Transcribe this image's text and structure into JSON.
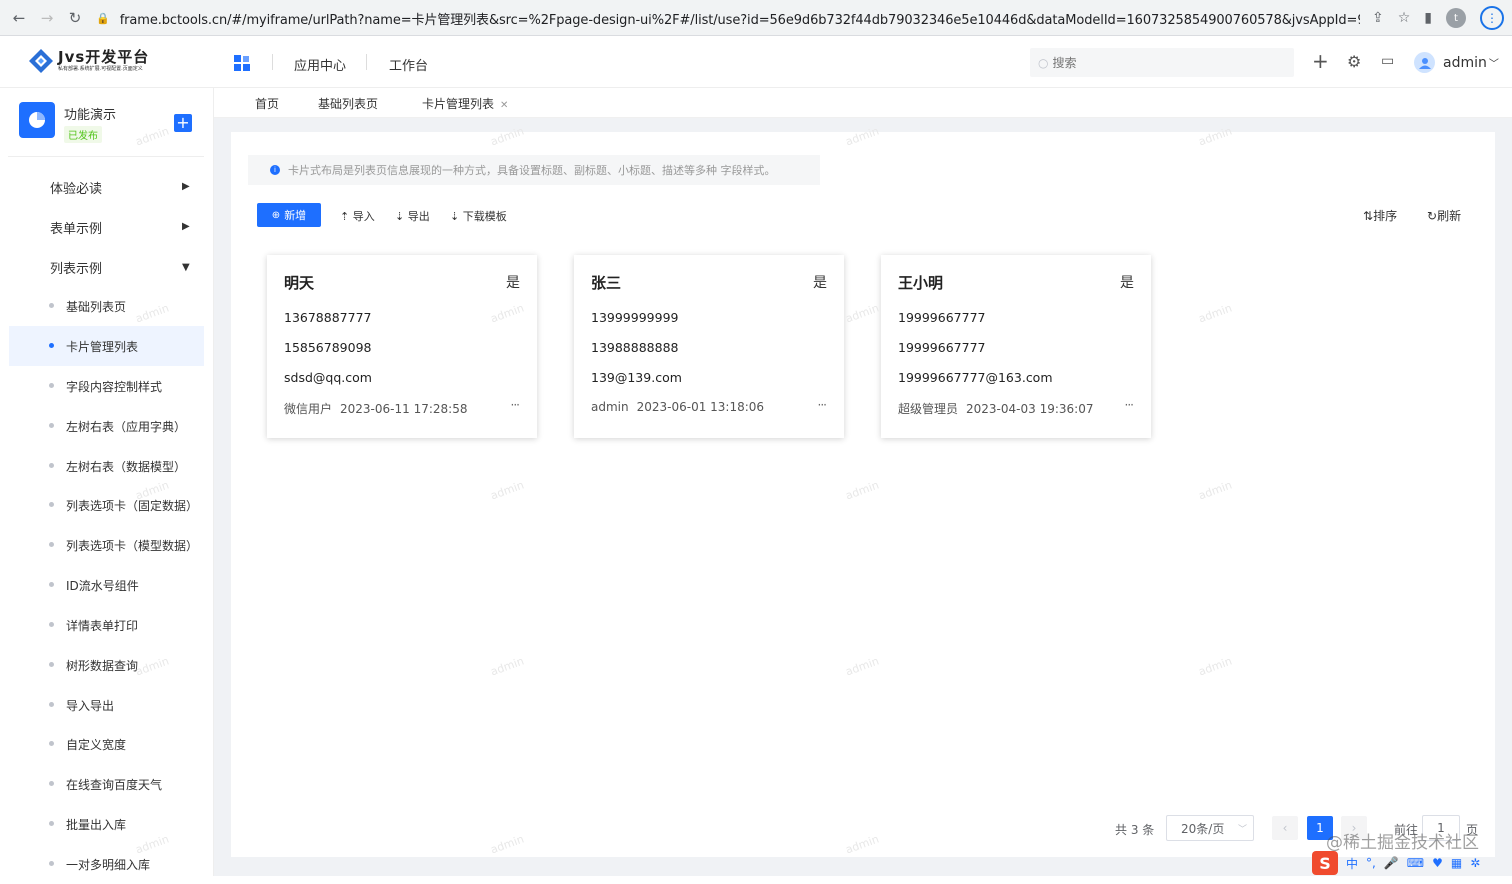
{
  "browser": {
    "url": "frame.bctools.cn/#/myiframe/urlPath?name=卡片管理列表&src=%2Fpage-design-ui%2F#/list/use?id=56e9d6b732f44db79032346e5e10446d&dataModelId=1607325854900760578&jvsAppId=9833755a4c4...",
    "profile_initial": "t"
  },
  "header": {
    "logo_title": "Jvs开发平台",
    "logo_sub": "私有部署.系统扩展.可视配置.页面定义",
    "nav": [
      "应用中心",
      "工作台"
    ],
    "search_placeholder": "搜索",
    "user_name": "admin"
  },
  "sidebar": {
    "app_name": "功能演示",
    "app_status": "已发布",
    "groups": [
      {
        "label": "体验必读",
        "arrow": "▶"
      },
      {
        "label": "表单示例",
        "arrow": "▶"
      },
      {
        "label": "列表示例",
        "arrow": "▼"
      }
    ],
    "items": [
      "基础列表页",
      "卡片管理列表",
      "字段内容控制样式",
      "左树右表（应用字典）",
      "左树右表（数据模型）",
      "列表选项卡（固定数据）",
      "列表选项卡（模型数据）",
      "ID流水号组件",
      "详情表单打印",
      "树形数据查询",
      "导入导出",
      "自定义宽度",
      "在线查询百度天气",
      "批量出入库",
      "一对多明细入库"
    ]
  },
  "tabs": [
    "首页",
    "基础列表页",
    "卡片管理列表"
  ],
  "notice": "卡片式布局是列表页信息展现的一种方式，具备设置标题、副标题、小标题、描述等多种 字段样式。",
  "toolbar": {
    "new": "新增",
    "import": "导入",
    "export": "导出",
    "download": "下载模板",
    "sort": "排序",
    "refresh": "刷新"
  },
  "cards": [
    {
      "title": "明天",
      "flag": "是",
      "line1": "13678887777",
      "line2": "15856789098",
      "line3": "sdsd@qq.com",
      "user": "微信用户",
      "time": "2023-06-11 17:28:58",
      "more": "···"
    },
    {
      "title": "张三",
      "flag": "是",
      "line1": "13999999999",
      "line2": "13988888888",
      "line3": "139@139.com",
      "user": "admin",
      "time": "2023-06-01 13:18:06",
      "more": "···"
    },
    {
      "title": "王小明",
      "flag": "是",
      "line1": "19999667777",
      "line2": "19999667777",
      "line3": "19999667777@163.com",
      "user": "超级管理员",
      "time": "2023-04-03 19:36:07",
      "more": "···"
    }
  ],
  "pagination": {
    "total": "共 3 条",
    "page_size": "20条/页",
    "current": "1",
    "goto_prefix": "前往",
    "goto_value": "1",
    "goto_suffix": "页"
  },
  "watermark": "admin",
  "overlay": {
    "site": "@稀土掘金技术社区",
    "ime_logo": "S",
    "ime_lang": "中"
  },
  "colors": {
    "primary": "#1e6fff",
    "badge_green": "#52c41a"
  }
}
